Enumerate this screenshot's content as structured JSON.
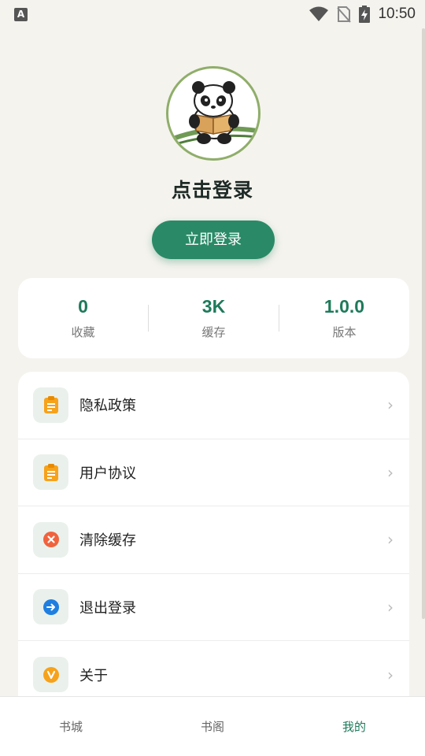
{
  "status_bar": {
    "notification_letter": "A",
    "time": "10:50"
  },
  "profile": {
    "title": "点击登录",
    "login_button": "立即登录"
  },
  "stats": [
    {
      "value": "0",
      "label": "收藏"
    },
    {
      "value": "3K",
      "label": "缓存"
    },
    {
      "value": "1.0.0",
      "label": "版本"
    }
  ],
  "menu": [
    {
      "label": "隐私政策",
      "icon": "clipboard-icon"
    },
    {
      "label": "用户协议",
      "icon": "clipboard-icon"
    },
    {
      "label": "清除缓存",
      "icon": "clear-icon"
    },
    {
      "label": "退出登录",
      "icon": "logout-icon"
    },
    {
      "label": "关于",
      "icon": "about-icon"
    }
  ],
  "chevron": "›",
  "bottom_nav": [
    {
      "label": "书城",
      "active": false
    },
    {
      "label": "书阁",
      "active": false
    },
    {
      "label": "我的",
      "active": true
    }
  ],
  "colors": {
    "accent": "#2a8a67",
    "accent_text": "#1e7a5a",
    "background": "#f5f3ee"
  }
}
